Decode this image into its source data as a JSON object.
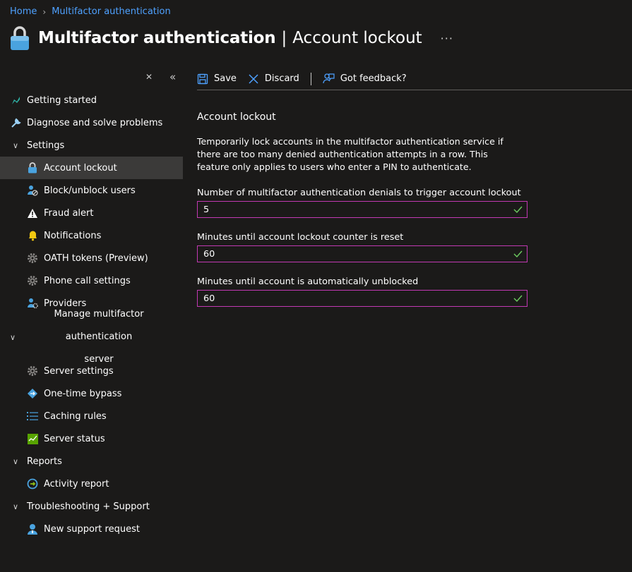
{
  "breadcrumb": {
    "home": "Home",
    "current": "Multifactor authentication"
  },
  "header": {
    "title": "Multifactor authentication",
    "subtitle": "Account lockout",
    "more": "···"
  },
  "sidebar": {
    "items": [
      {
        "label": "Getting started",
        "icon": "getting-started-icon"
      },
      {
        "label": "Diagnose and solve problems",
        "icon": "wrench-icon"
      },
      {
        "label": "Settings",
        "icon": "chevron-down-icon"
      },
      {
        "label": "Account lockout",
        "icon": "lock-icon"
      },
      {
        "label": "Block/unblock users",
        "icon": "block-users-icon"
      },
      {
        "label": "Fraud alert",
        "icon": "warning-icon"
      },
      {
        "label": "Notifications",
        "icon": "bell-icon"
      },
      {
        "label": "OATH tokens (Preview)",
        "icon": "gear-icon"
      },
      {
        "label": "Phone call settings",
        "icon": "gear-icon"
      },
      {
        "label": "Providers",
        "icon": "providers-icon"
      },
      {
        "label_line1": "Manage multifactor authentication",
        "label_line2": "server",
        "icon": "chevron-down-icon"
      },
      {
        "label": "Server settings",
        "icon": "gear-icon"
      },
      {
        "label": "One-time bypass",
        "icon": "bypass-icon"
      },
      {
        "label": "Caching rules",
        "icon": "list-icon"
      },
      {
        "label": "Server status",
        "icon": "server-status-icon"
      },
      {
        "label": "Reports",
        "icon": "chevron-down-icon"
      },
      {
        "label": "Activity report",
        "icon": "activity-report-icon"
      },
      {
        "label": "Troubleshooting + Support",
        "icon": "chevron-down-icon"
      },
      {
        "label": "New support request",
        "icon": "support-icon"
      }
    ]
  },
  "toolbar": {
    "save": "Save",
    "discard": "Discard",
    "feedback": "Got feedback?"
  },
  "main": {
    "section_title": "Account lockout",
    "description": "Temporarily lock accounts in the multifactor authentication service if there are too many denied authentication attempts in a row. This feature only applies to users who enter a PIN to authenticate.",
    "fields": [
      {
        "label": "Number of multifactor authentication denials to trigger account lockout",
        "value": "5"
      },
      {
        "label": "Minutes until account lockout counter is reset",
        "value": "60"
      },
      {
        "label": "Minutes until account is automatically unblocked",
        "value": "60"
      }
    ]
  },
  "colors": {
    "accent": "#4ea1ff",
    "field_border": "#c239b3",
    "check": "#6ccb5f",
    "active_bg": "#3b3a39"
  }
}
